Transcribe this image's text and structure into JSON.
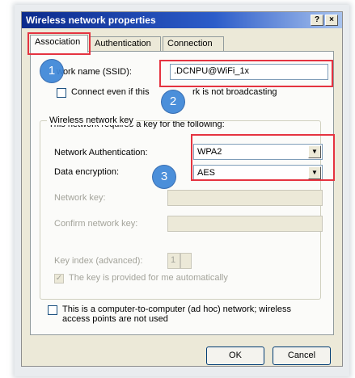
{
  "window": {
    "title": "Wireless network properties",
    "help_button": "?",
    "close_button": "×"
  },
  "tabs": [
    {
      "label": "Association",
      "active": true
    },
    {
      "label": "Authentication",
      "active": false
    },
    {
      "label": "Connection",
      "active": false
    }
  ],
  "association": {
    "ssid_label": "Network name (SSID):",
    "ssid_label_visible": "work name (SSID):",
    "ssid_value": ".DCNPU@WiFi_1x",
    "broadcast_checkbox_label_left": "Connect even if this",
    "broadcast_checkbox_label_right": "rk is not broadcasting",
    "broadcast_checked": false,
    "key_group_title": "Wireless network key",
    "key_requirement_text": "This network requires a key for the following:",
    "network_auth_label": "Network Authentication:",
    "network_auth_value": "WPA2",
    "data_encryption_label": "Data encryption:",
    "data_encryption_value": "AES",
    "network_key_label": "Network key:",
    "confirm_key_label": "Confirm network key:",
    "key_index_label": "Key index (advanced):",
    "key_index_value": "1",
    "auto_key_label": "The key is provided for me automatically",
    "auto_key_checked": true,
    "adhoc_label_line1": "This is a computer-to-computer (ad hoc) network; wireless",
    "adhoc_label_line2": "access points are not used",
    "adhoc_checked": false
  },
  "buttons": {
    "ok": "OK",
    "cancel": "Cancel"
  },
  "annotations": {
    "badge1": "1",
    "badge2": "2",
    "badge3": "3",
    "highlight_color": "#e53340",
    "badge_color": "#3d86d8"
  },
  "icons": {
    "checkmark": "checkmark-icon",
    "dropdown": "chevron-down-icon",
    "spin": "spin-arrows-icon"
  }
}
